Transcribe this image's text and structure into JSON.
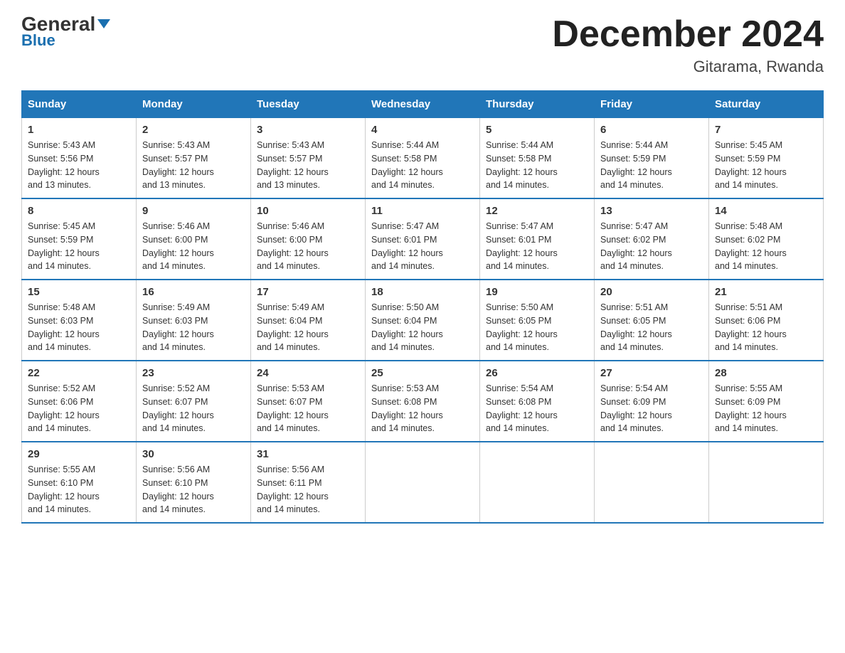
{
  "logo": {
    "name": "General",
    "name_blue": "Blue"
  },
  "title": "December 2024",
  "subtitle": "Gitarama, Rwanda",
  "days_of_week": [
    "Sunday",
    "Monday",
    "Tuesday",
    "Wednesday",
    "Thursday",
    "Friday",
    "Saturday"
  ],
  "weeks": [
    [
      {
        "day": "1",
        "sunrise": "5:43 AM",
        "sunset": "5:56 PM",
        "daylight": "12 hours and 13 minutes."
      },
      {
        "day": "2",
        "sunrise": "5:43 AM",
        "sunset": "5:57 PM",
        "daylight": "12 hours and 13 minutes."
      },
      {
        "day": "3",
        "sunrise": "5:43 AM",
        "sunset": "5:57 PM",
        "daylight": "12 hours and 13 minutes."
      },
      {
        "day": "4",
        "sunrise": "5:44 AM",
        "sunset": "5:58 PM",
        "daylight": "12 hours and 14 minutes."
      },
      {
        "day": "5",
        "sunrise": "5:44 AM",
        "sunset": "5:58 PM",
        "daylight": "12 hours and 14 minutes."
      },
      {
        "day": "6",
        "sunrise": "5:44 AM",
        "sunset": "5:59 PM",
        "daylight": "12 hours and 14 minutes."
      },
      {
        "day": "7",
        "sunrise": "5:45 AM",
        "sunset": "5:59 PM",
        "daylight": "12 hours and 14 minutes."
      }
    ],
    [
      {
        "day": "8",
        "sunrise": "5:45 AM",
        "sunset": "5:59 PM",
        "daylight": "12 hours and 14 minutes."
      },
      {
        "day": "9",
        "sunrise": "5:46 AM",
        "sunset": "6:00 PM",
        "daylight": "12 hours and 14 minutes."
      },
      {
        "day": "10",
        "sunrise": "5:46 AM",
        "sunset": "6:00 PM",
        "daylight": "12 hours and 14 minutes."
      },
      {
        "day": "11",
        "sunrise": "5:47 AM",
        "sunset": "6:01 PM",
        "daylight": "12 hours and 14 minutes."
      },
      {
        "day": "12",
        "sunrise": "5:47 AM",
        "sunset": "6:01 PM",
        "daylight": "12 hours and 14 minutes."
      },
      {
        "day": "13",
        "sunrise": "5:47 AM",
        "sunset": "6:02 PM",
        "daylight": "12 hours and 14 minutes."
      },
      {
        "day": "14",
        "sunrise": "5:48 AM",
        "sunset": "6:02 PM",
        "daylight": "12 hours and 14 minutes."
      }
    ],
    [
      {
        "day": "15",
        "sunrise": "5:48 AM",
        "sunset": "6:03 PM",
        "daylight": "12 hours and 14 minutes."
      },
      {
        "day": "16",
        "sunrise": "5:49 AM",
        "sunset": "6:03 PM",
        "daylight": "12 hours and 14 minutes."
      },
      {
        "day": "17",
        "sunrise": "5:49 AM",
        "sunset": "6:04 PM",
        "daylight": "12 hours and 14 minutes."
      },
      {
        "day": "18",
        "sunrise": "5:50 AM",
        "sunset": "6:04 PM",
        "daylight": "12 hours and 14 minutes."
      },
      {
        "day": "19",
        "sunrise": "5:50 AM",
        "sunset": "6:05 PM",
        "daylight": "12 hours and 14 minutes."
      },
      {
        "day": "20",
        "sunrise": "5:51 AM",
        "sunset": "6:05 PM",
        "daylight": "12 hours and 14 minutes."
      },
      {
        "day": "21",
        "sunrise": "5:51 AM",
        "sunset": "6:06 PM",
        "daylight": "12 hours and 14 minutes."
      }
    ],
    [
      {
        "day": "22",
        "sunrise": "5:52 AM",
        "sunset": "6:06 PM",
        "daylight": "12 hours and 14 minutes."
      },
      {
        "day": "23",
        "sunrise": "5:52 AM",
        "sunset": "6:07 PM",
        "daylight": "12 hours and 14 minutes."
      },
      {
        "day": "24",
        "sunrise": "5:53 AM",
        "sunset": "6:07 PM",
        "daylight": "12 hours and 14 minutes."
      },
      {
        "day": "25",
        "sunrise": "5:53 AM",
        "sunset": "6:08 PM",
        "daylight": "12 hours and 14 minutes."
      },
      {
        "day": "26",
        "sunrise": "5:54 AM",
        "sunset": "6:08 PM",
        "daylight": "12 hours and 14 minutes."
      },
      {
        "day": "27",
        "sunrise": "5:54 AM",
        "sunset": "6:09 PM",
        "daylight": "12 hours and 14 minutes."
      },
      {
        "day": "28",
        "sunrise": "5:55 AM",
        "sunset": "6:09 PM",
        "daylight": "12 hours and 14 minutes."
      }
    ],
    [
      {
        "day": "29",
        "sunrise": "5:55 AM",
        "sunset": "6:10 PM",
        "daylight": "12 hours and 14 minutes."
      },
      {
        "day": "30",
        "sunrise": "5:56 AM",
        "sunset": "6:10 PM",
        "daylight": "12 hours and 14 minutes."
      },
      {
        "day": "31",
        "sunrise": "5:56 AM",
        "sunset": "6:11 PM",
        "daylight": "12 hours and 14 minutes."
      },
      null,
      null,
      null,
      null
    ]
  ],
  "labels": {
    "sunrise": "Sunrise:",
    "sunset": "Sunset:",
    "daylight": "Daylight:"
  },
  "colors": {
    "header_bg": "#2176b8",
    "header_text": "#ffffff",
    "border": "#2176b8"
  }
}
